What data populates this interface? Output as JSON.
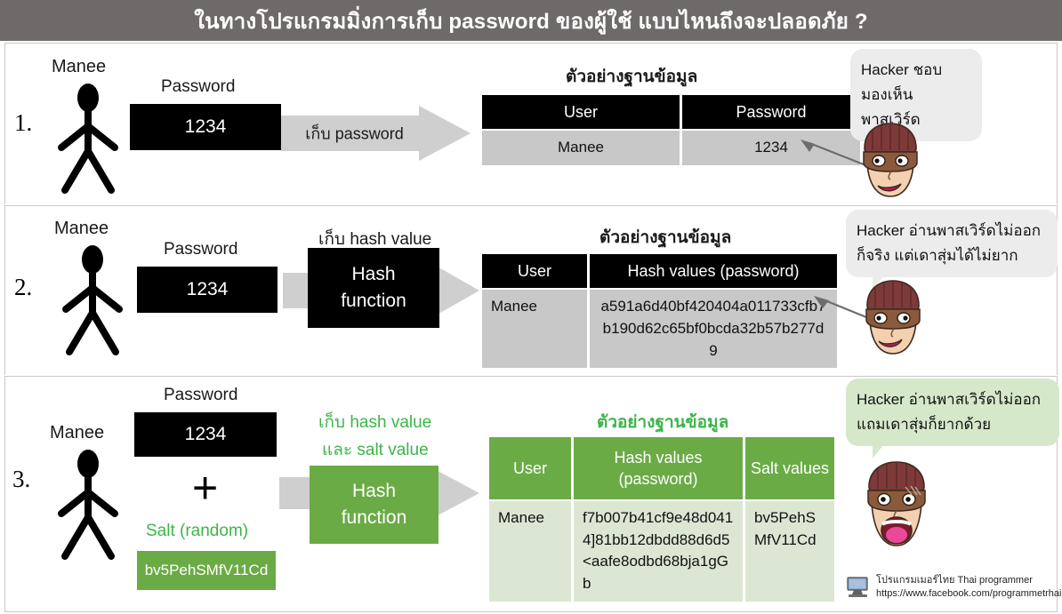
{
  "title": "ในทางโปรแกรมมิ่งการเก็บ password ของผู้ใช้ แบบไหนถึงจะปลอดภัย ?",
  "colors": {
    "titlebar_bg": "#6e6a69",
    "black_box": "#000000",
    "green_accent": "#6bab46",
    "green_text": "#3cb54a",
    "arrow_gray": "#cfcfcf",
    "bubble_gray": "#ececec",
    "bubble_green": "#d5e8ca",
    "table_row_gray": "#c8c8c8",
    "table_row_green": "#dbe7d3"
  },
  "sections": [
    {
      "number": "1.",
      "person_name": "Manee",
      "password_label": "Password",
      "password_value": "1234",
      "arrow_label": "เก็บ password",
      "db_title": "ตัวอย่างฐานข้อมูล",
      "table": {
        "headers": [
          "User",
          "Password"
        ],
        "rows": [
          [
            "Manee",
            "1234"
          ]
        ]
      },
      "bubble_lines": [
        "Hacker ชอบ",
        "มองเห็นพาสเวิร์ด"
      ],
      "hacker_mood": "smiling"
    },
    {
      "number": "2.",
      "person_name": "Manee",
      "password_label": "Password",
      "password_value": "1234",
      "arrow_label": "เก็บ hash value",
      "hash_box_line1": "Hash",
      "hash_box_line2": "function",
      "db_title": "ตัวอย่างฐานข้อมูล",
      "table": {
        "headers": [
          "User",
          "Hash values (password)"
        ],
        "rows": [
          [
            "Manee",
            "a591a6d40bf420404a011733cfb7b190d62c65bf0bcda32b57b277d9"
          ]
        ]
      },
      "bubble_lines": [
        "Hacker อ่านพาสเวิร์ดไม่ออก",
        "ก็จริง แต่เดาสุ่มได้ไม่ยาก"
      ],
      "hacker_mood": "smirking"
    },
    {
      "number": "3.",
      "person_name": "Manee",
      "password_label": "Password",
      "password_value": "1234",
      "plus_symbol": "+",
      "salt_label": "Salt (random)",
      "salt_value": "bv5PehSMfV11Cd",
      "arrow_label_line1": "เก็บ hash value",
      "arrow_label_line2": "และ salt value",
      "hash_box_line1": "Hash",
      "hash_box_line2": "function",
      "db_title": "ตัวอย่างฐานข้อมูล",
      "table": {
        "headers": [
          "User",
          "Hash values (password)",
          "Salt values"
        ],
        "rows": [
          [
            "Manee",
            "f7b007b41cf9e48d0414]81bb12dbdd88d6d5<aafe8odbd68bja1gGb",
            "bv5PehSMfV11Cd"
          ]
        ]
      },
      "bubble_lines": [
        "Hacker อ่านพาสเวิร์ดไม่ออก",
        "แถมเดาสุ่มก็ยากด้วย"
      ],
      "hacker_mood": "screaming"
    }
  ],
  "credit": {
    "line1": "โปรแกรมเมอร์ไทย Thai programmer",
    "line2": "https://www.facebook.com/programmetrhai"
  }
}
